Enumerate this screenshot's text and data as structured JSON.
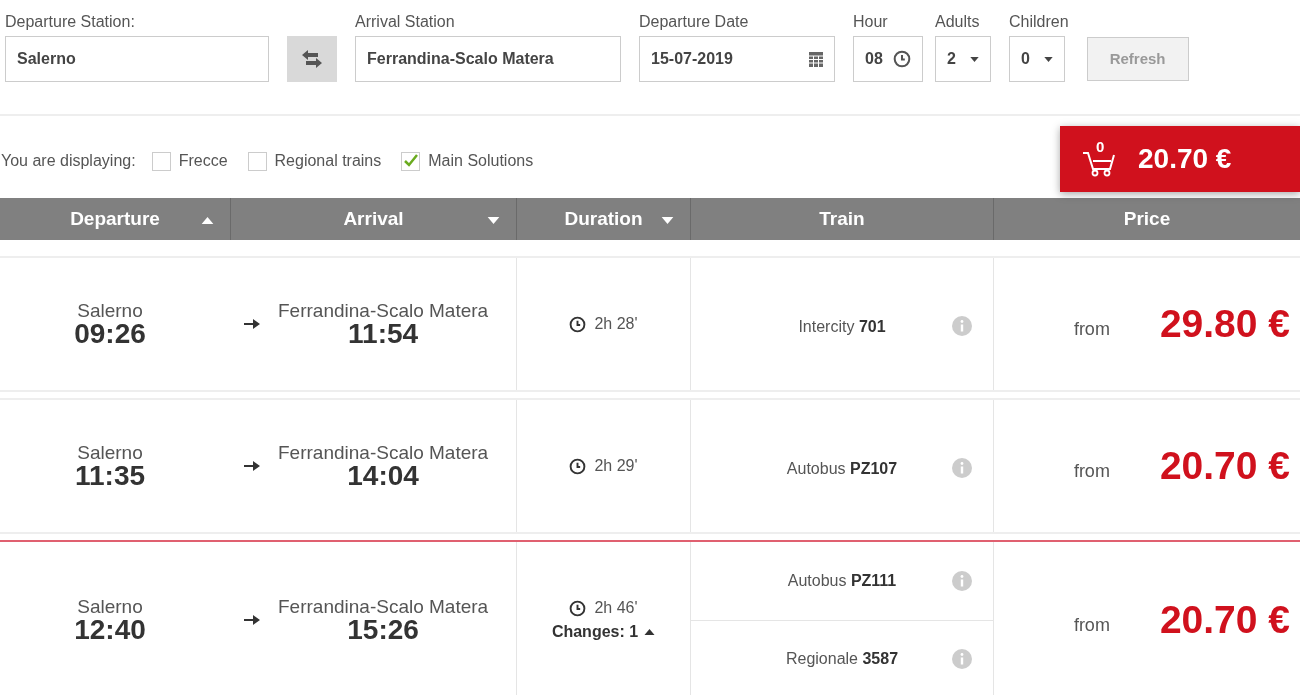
{
  "search": {
    "departure": {
      "label": "Departure Station:",
      "value": "Salerno"
    },
    "arrival": {
      "label": "Arrival Station",
      "value": "Ferrandina-Scalo Matera"
    },
    "date": {
      "label": "Departure Date",
      "value": "15-07-2019"
    },
    "hour": {
      "label": "Hour",
      "value": "08"
    },
    "adults": {
      "label": "Adults",
      "value": "2"
    },
    "children": {
      "label": "Children",
      "value": "0"
    },
    "refresh": {
      "label": "Refresh",
      "disabled": true
    }
  },
  "filters": {
    "label": "You are displaying:",
    "options": [
      {
        "label": "Frecce",
        "checked": false
      },
      {
        "label": "Regional trains",
        "checked": false
      },
      {
        "label": "Main Solutions",
        "checked": true
      }
    ]
  },
  "cart": {
    "count": "0",
    "total": "20.70 €"
  },
  "table": {
    "columns": [
      {
        "label": "Departure",
        "sortable": true,
        "sorted_up": true
      },
      {
        "label": "Arrival",
        "sortable": true,
        "sorted_up": false
      },
      {
        "label": "Duration",
        "sortable": true,
        "sorted_up": false
      },
      {
        "label": "Train",
        "sortable": false
      },
      {
        "label": "Price",
        "sortable": false
      }
    ],
    "rows": [
      {
        "selected": false,
        "from": "Salerno",
        "dep": "09:26",
        "to": "Ferrandina-Scalo Matera",
        "arr": "11:54",
        "duration": "2h 28'",
        "trains": [
          "Intercity **701**"
        ],
        "price_prefix": "from",
        "price": "29.80 €"
      },
      {
        "selected": false,
        "from": "Salerno",
        "dep": "11:35",
        "to": "Ferrandina-Scalo Matera",
        "arr": "14:04",
        "duration": "2h 29'",
        "trains": [
          "Autobus **PZ107**"
        ],
        "price_prefix": "from",
        "price": "20.70 €"
      },
      {
        "selected": true,
        "from": "Salerno",
        "dep": "12:40",
        "to": "Ferrandina-Scalo Matera",
        "arr": "15:26",
        "duration": "2h 46'",
        "changes": {
          "label": "Changes: 1",
          "expanded": true
        },
        "trains": [
          "Autobus **PZ111**",
          "Regionale **3587**"
        ],
        "price_prefix": "from",
        "price": "20.70 €"
      }
    ]
  }
}
